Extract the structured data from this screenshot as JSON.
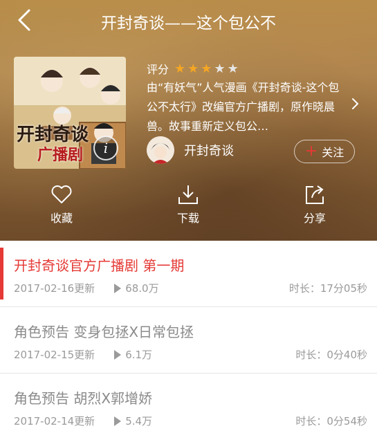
{
  "header": {
    "title": "开封奇谈——这个包公不"
  },
  "album": {
    "cover_title": "开封奇谈",
    "cover_subtitle": "广播剧",
    "rating_label": "评分",
    "rating": {
      "value": 3,
      "max": 5,
      "filled_color": "#f5a623",
      "empty_color": "#e6e6e6"
    },
    "description": "由“有妖气”人气漫画《开封奇谈-这个包公不太行》改编官方广播剧，原作晓晨兽。故事重新定义包公…",
    "author": "开封奇谈",
    "follow_label": "关注"
  },
  "actions": [
    {
      "label": "收藏",
      "icon": "heart-icon"
    },
    {
      "label": "下载",
      "icon": "download-icon"
    },
    {
      "label": "分享",
      "icon": "share-icon"
    }
  ],
  "episodes": [
    {
      "title": "开封奇谈官方广播剧 第一期",
      "date": "2017-02-16更新",
      "plays": "68.0万",
      "duration": "时长：17分05秒",
      "active": true
    },
    {
      "title": "角色预告 变身包拯X日常包拯",
      "date": "2017-02-15更新",
      "plays": "6.1万",
      "duration": "时长：0分40秒",
      "active": false
    },
    {
      "title": "角色预告 胡烈X郭增娇",
      "date": "2017-02-14更新",
      "plays": "5.4万",
      "duration": "时长：0分54秒",
      "active": false
    }
  ],
  "colors": {
    "accent": "#e53935",
    "muted": "#9a9a9a"
  }
}
